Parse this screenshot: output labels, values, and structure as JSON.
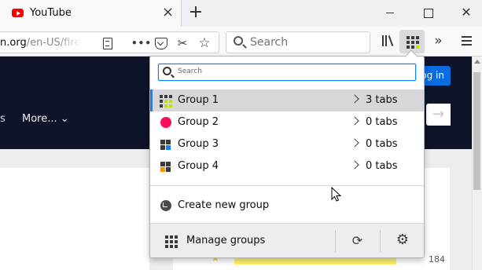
{
  "tab": {
    "title": "YouTube",
    "close": "×"
  },
  "newtab": {
    "label": "+"
  },
  "window": {
    "close": "✕"
  },
  "urlbar": {
    "url_main": "n.org",
    "url_dim": "/en-US/fire"
  },
  "toolbar": {
    "dots": "•••",
    "screenshot": "✂",
    "star": "☆",
    "search_placeholder": "Search",
    "overflow": "»"
  },
  "page": {
    "login": "Log in",
    "nav_s": "s",
    "more": "More...",
    "more_chevron": "⌄",
    "arrow": "→",
    "count": "184",
    "star": "★"
  },
  "panel": {
    "search_placeholder": "Search",
    "groups": [
      {
        "name": "Group 1",
        "tabs": "3 tabs",
        "active": true
      },
      {
        "name": "Group 2",
        "tabs": "0 tabs",
        "active": false
      },
      {
        "name": "Group 3",
        "tabs": "0 tabs",
        "active": false
      },
      {
        "name": "Group 4",
        "tabs": "0 tabs",
        "active": false
      }
    ],
    "create_label": "Create new group",
    "manage_label": "Manage groups",
    "refresh": "⟳",
    "settings": "⚙"
  },
  "colors": {
    "accent": "#0a84ff",
    "group2": "#ff0c5b",
    "group3_accent": "#0a84ff",
    "group4_accent": "#ff9400",
    "group1_accent": "#b8e600"
  }
}
